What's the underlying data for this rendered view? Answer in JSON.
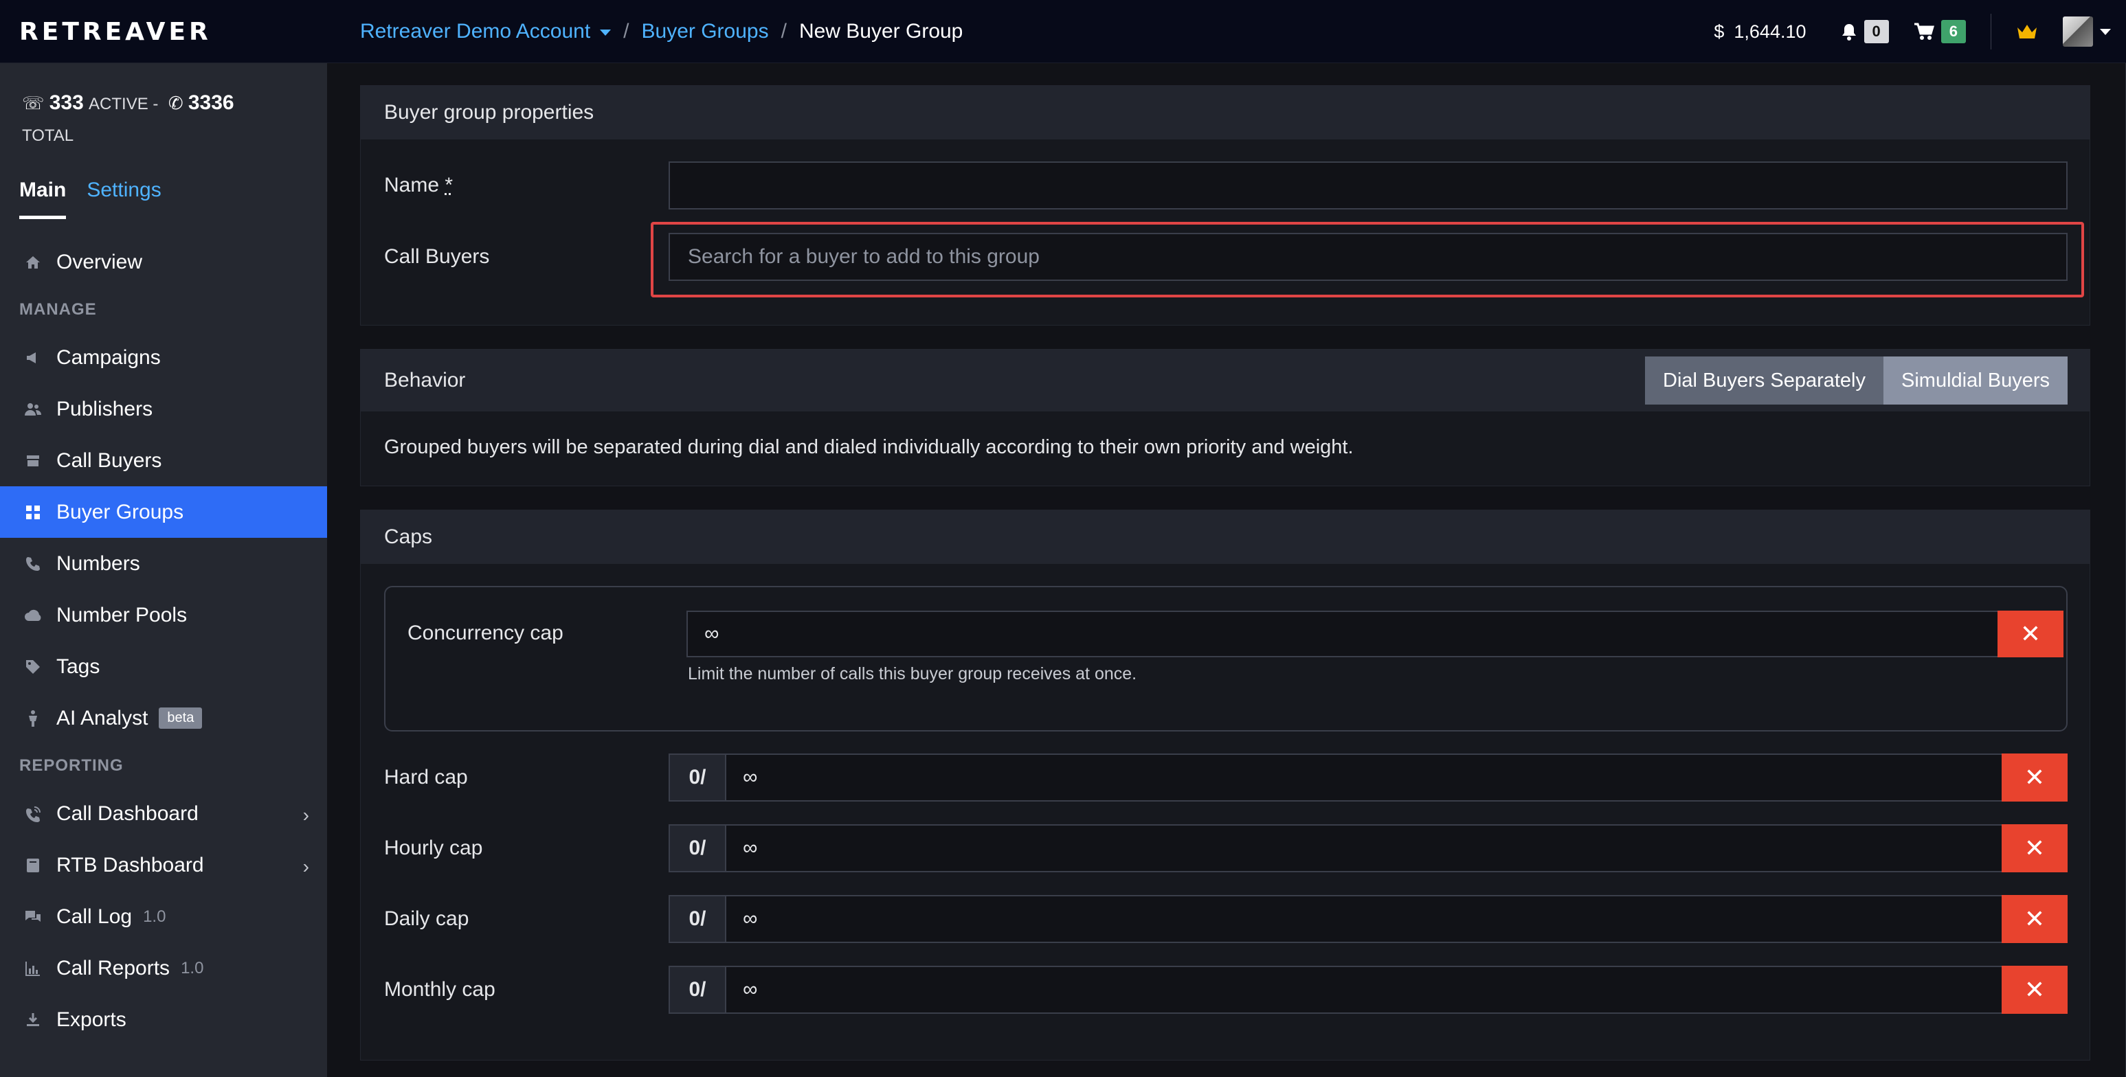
{
  "header": {
    "logo": "RETREAVER",
    "breadcrumbs": [
      "Retreaver Demo Account",
      "Buyer Groups",
      "New Buyer Group"
    ],
    "balance_symbol": "$",
    "balance": "1,644.10",
    "notifications_count": "0",
    "cart_count": "6"
  },
  "sidebar": {
    "active_count": "333",
    "active_label": "ACTIVE -",
    "total_count": "3336",
    "total_label": "TOTAL",
    "tab_main": "Main",
    "tab_settings": "Settings",
    "items": {
      "overview": "Overview",
      "manage_header": "MANAGE",
      "campaigns": "Campaigns",
      "publishers": "Publishers",
      "call_buyers": "Call Buyers",
      "buyer_groups": "Buyer Groups",
      "numbers": "Numbers",
      "number_pools": "Number Pools",
      "tags": "Tags",
      "ai_analyst": "AI Analyst",
      "ai_badge": "beta",
      "reporting_header": "REPORTING",
      "call_dashboard": "Call Dashboard",
      "rtb_dashboard": "RTB Dashboard",
      "call_log": "Call Log",
      "call_log_ver": "1.0",
      "call_reports": "Call Reports",
      "call_reports_ver": "1.0",
      "exports": "Exports"
    }
  },
  "properties": {
    "title": "Buyer group properties",
    "name_label": "Name",
    "name_required": "*",
    "name_value": "",
    "call_buyers_label": "Call Buyers",
    "call_buyers_placeholder": "Search for a buyer to add to this group"
  },
  "behavior": {
    "title": "Behavior",
    "btn_separate": "Dial Buyers Separately",
    "btn_simuldial": "Simuldial Buyers",
    "description": "Grouped buyers will be separated during dial and dialed individually according to their own priority and weight."
  },
  "caps": {
    "title": "Caps",
    "concurrency_label": "Concurrency cap",
    "concurrency_value": "∞",
    "concurrency_help": "Limit the number of calls this buyer group receives at once.",
    "rows": [
      {
        "label": "Hard cap",
        "prefix": "0/",
        "value": "∞"
      },
      {
        "label": "Hourly cap",
        "prefix": "0/",
        "value": "∞"
      },
      {
        "label": "Daily cap",
        "prefix": "0/",
        "value": "∞"
      },
      {
        "label": "Monthly cap",
        "prefix": "0/",
        "value": "∞"
      }
    ],
    "clear_symbol": "✕"
  }
}
